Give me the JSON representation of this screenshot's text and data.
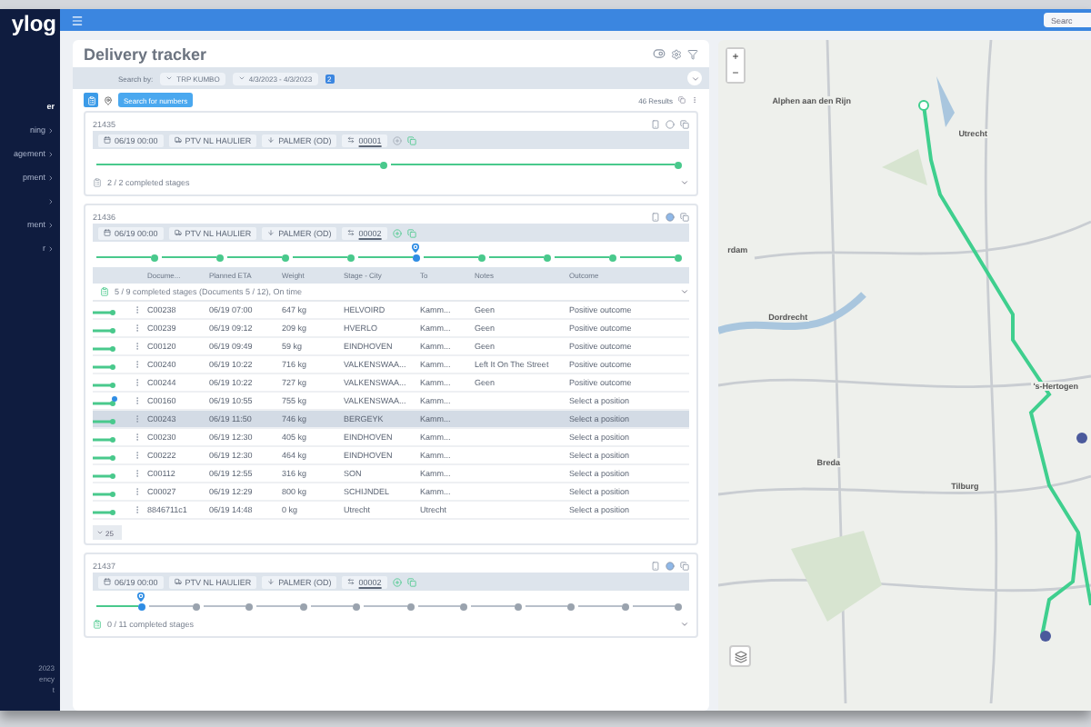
{
  "sidebar": {
    "logo": "ylog",
    "items": [
      {
        "label": "er",
        "selected": true,
        "chevron": false
      },
      {
        "label": "ning",
        "selected": false,
        "chevron": true
      },
      {
        "label": "agement",
        "selected": false,
        "chevron": true
      },
      {
        "label": "pment",
        "selected": false,
        "chevron": true
      },
      {
        "selected": false,
        "chevron": true
      },
      {
        "label": "ment",
        "selected": false,
        "chevron": true
      },
      {
        "label": "r",
        "selected": false,
        "chevron": true
      }
    ],
    "footer": [
      "2023",
      "ency",
      "t"
    ]
  },
  "topbar": {
    "search_button": "Searc"
  },
  "page": {
    "title": "Delivery tracker"
  },
  "filters": {
    "label": "Search by:",
    "chips": [
      "TRP KUMBO",
      "4/3/2023 - 4/3/2023"
    ],
    "badge": "2"
  },
  "toolbar": {
    "action_button": "Search for numbers",
    "results": "46 Results"
  },
  "cards": [
    {
      "number": "21435",
      "chips": [
        "06/19 00:00",
        "PTV NL HAULIER",
        "PALMER (OD)",
        "00001"
      ],
      "active": false,
      "stages": [
        {
          "done": true,
          "current": false
        },
        {
          "done": true,
          "current": false
        }
      ],
      "summary": "2 / 2 completed stages",
      "expanded": false
    },
    {
      "number": "21436",
      "chips": [
        "06/19 00:00",
        "PTV NL HAULIER",
        "PALMER (OD)",
        "00002"
      ],
      "active": true,
      "stages": [
        {
          "done": true,
          "current": false
        },
        {
          "done": true,
          "current": false
        },
        {
          "done": true,
          "current": false
        },
        {
          "done": true,
          "current": false
        },
        {
          "done": true,
          "current": true
        },
        {
          "done": true,
          "current": false
        },
        {
          "done": true,
          "current": false
        },
        {
          "done": true,
          "current": false
        },
        {
          "done": true,
          "current": false
        }
      ],
      "expanded": true,
      "table": {
        "columns": [
          "Docume...",
          "Planned ETA",
          "Weight",
          "Stage - City",
          "To",
          "Notes",
          "Outcome"
        ],
        "group": "5 / 9 completed stages (Documents 5 / 12), On time",
        "rows": [
          {
            "marker": false,
            "selected": false,
            "cells": [
              "C00238",
              "06/19 07:00",
              "647 kg",
              "HELVOIRD",
              "Kamm...",
              "Geen",
              "Positive outcome"
            ]
          },
          {
            "marker": false,
            "selected": false,
            "cells": [
              "C00239",
              "06/19 09:12",
              "209 kg",
              "HVERLO",
              "Kamm...",
              "Geen",
              "Positive outcome"
            ]
          },
          {
            "marker": false,
            "selected": false,
            "cells": [
              "C00120",
              "06/19 09:49",
              "59 kg",
              "EINDHOVEN",
              "Kamm...",
              "Geen",
              "Positive outcome"
            ]
          },
          {
            "marker": false,
            "selected": false,
            "cells": [
              "C00240",
              "06/19 10:22",
              "716 kg",
              "VALKENSWAA...",
              "Kamm...",
              "Left It On The Street",
              "Positive outcome"
            ]
          },
          {
            "marker": false,
            "selected": false,
            "cells": [
              "C00244",
              "06/19 10:22",
              "727 kg",
              "VALKENSWAA...",
              "Kamm...",
              "Geen",
              "Positive outcome"
            ]
          },
          {
            "marker": true,
            "selected": false,
            "cells": [
              "C00160",
              "06/19 10:55",
              "755 kg",
              "VALKENSWAA...",
              "Kamm...",
              "",
              "Select a position"
            ]
          },
          {
            "marker": false,
            "selected": true,
            "cells": [
              "C00243",
              "06/19 11:50",
              "746 kg",
              "BERGEYK",
              "Kamm...",
              "",
              "Select a position"
            ]
          },
          {
            "marker": false,
            "selected": false,
            "cells": [
              "C00230",
              "06/19 12:30",
              "405 kg",
              "EINDHOVEN",
              "Kamm...",
              "",
              "Select a position"
            ]
          },
          {
            "marker": false,
            "selected": false,
            "cells": [
              "C00222",
              "06/19 12:30",
              "464 kg",
              "EINDHOVEN",
              "Kamm...",
              "",
              "Select a position"
            ]
          },
          {
            "marker": false,
            "selected": false,
            "cells": [
              "C00112",
              "06/19 12:55",
              "316 kg",
              "SON",
              "Kamm...",
              "",
              "Select a position"
            ]
          },
          {
            "marker": false,
            "selected": false,
            "cells": [
              "C00027",
              "06/19 12:29",
              "800 kg",
              "SCHIJNDEL",
              "Kamm...",
              "",
              "Select a position"
            ]
          },
          {
            "marker": false,
            "selected": false,
            "cells": [
              "8846711c1",
              "06/19 14:48",
              "0 kg",
              "Utrecht",
              "Utrecht",
              "",
              "Select a position"
            ]
          }
        ]
      },
      "pager": "25"
    },
    {
      "number": "21437",
      "chips": [
        "06/19 00:00",
        "PTV NL HAULIER",
        "PALMER (OD)",
        "00002"
      ],
      "active": true,
      "stages": [
        {
          "done": true,
          "current": true
        },
        {
          "done": false,
          "current": false
        },
        {
          "done": false,
          "current": false
        },
        {
          "done": false,
          "current": false
        },
        {
          "done": false,
          "current": false
        },
        {
          "done": false,
          "current": false
        },
        {
          "done": false,
          "current": false
        },
        {
          "done": false,
          "current": false
        },
        {
          "done": false,
          "current": false
        },
        {
          "done": false,
          "current": false
        },
        {
          "done": false,
          "current": false
        }
      ],
      "summary": "0 / 11 completed stages",
      "expanded": false
    }
  ],
  "map": {
    "zoom_in": "+",
    "zoom_out": "−",
    "places": [
      {
        "name": "Alphen aan den Rijn"
      },
      {
        "name": "Utrecht"
      },
      {
        "name": "rdam"
      },
      {
        "name": "Dordrecht"
      },
      {
        "name": "'s-Hertogen"
      },
      {
        "name": "Breda"
      },
      {
        "name": "Tilburg"
      }
    ]
  }
}
